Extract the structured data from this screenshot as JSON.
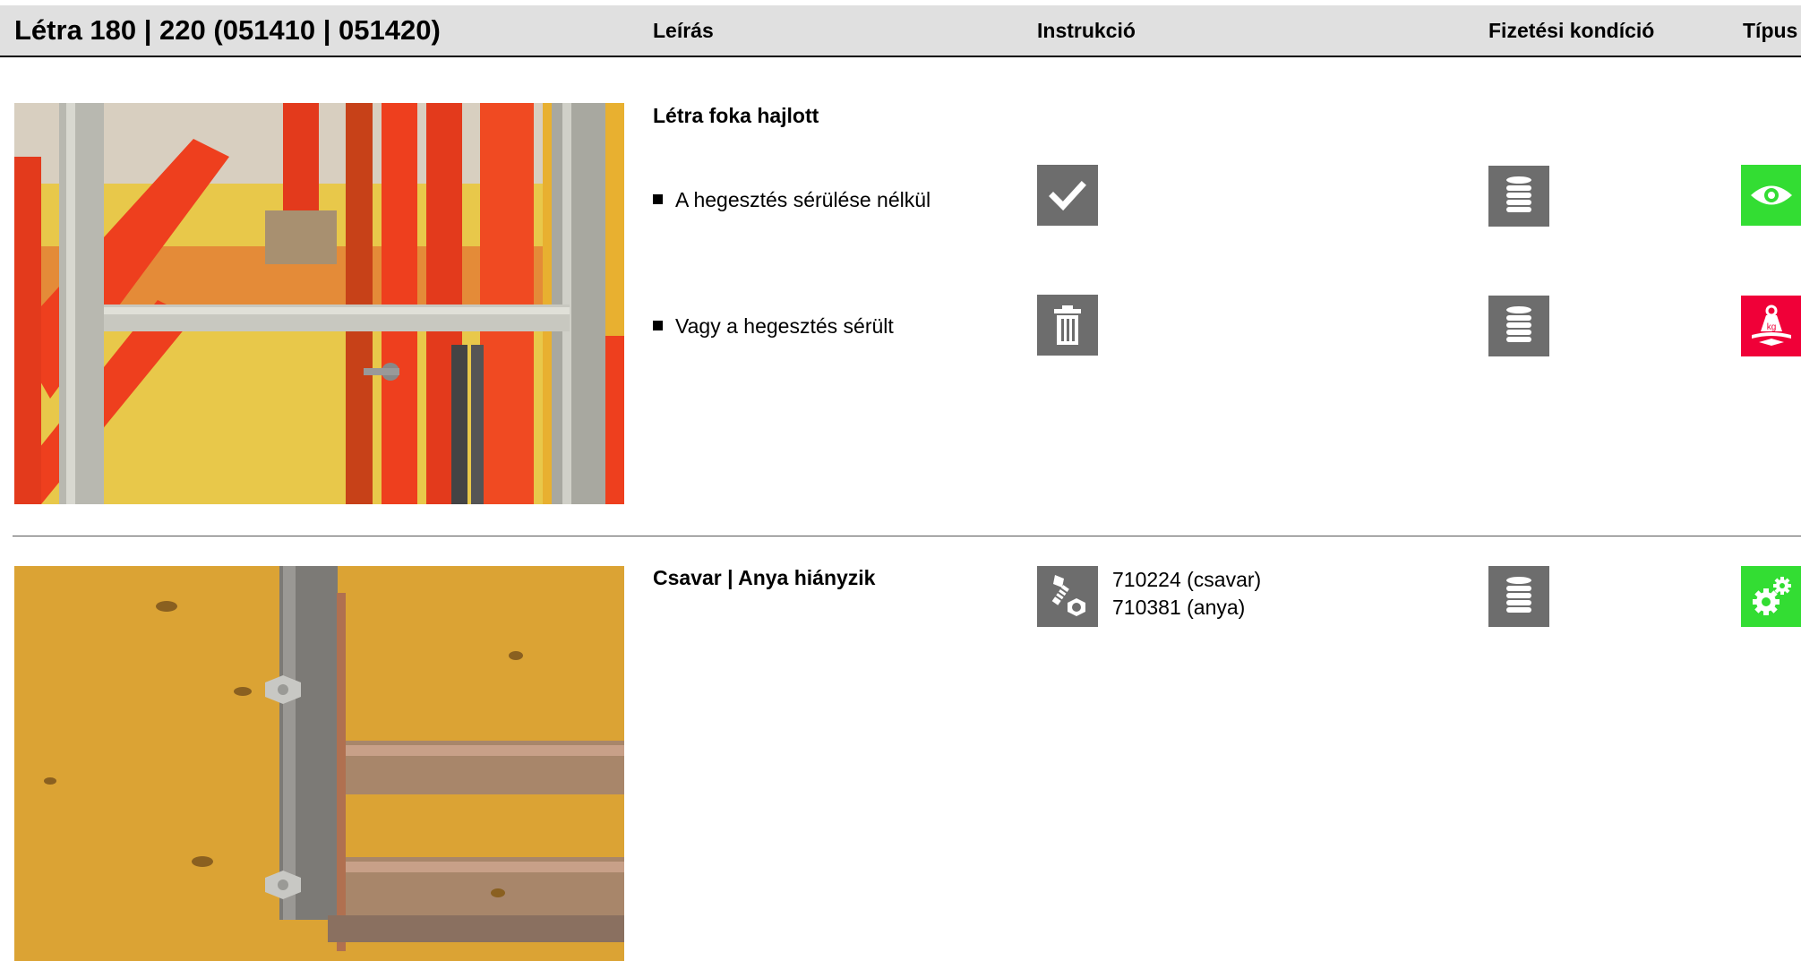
{
  "header": {
    "title": "Létra 180 | 220 (051410 | 051420)",
    "col_leiras": "Leírás",
    "col_instrukcio": "Instrukció",
    "col_fizetesi": "Fizetési kondíció",
    "col_tipus": "Típus"
  },
  "sections": [
    {
      "title": "Létra foka hajlott",
      "rows": [
        {
          "text": "A hegesztés sérülése nélkül",
          "instruction_icon": "checkmark-icon",
          "payment_icon": "coin-stack-icon",
          "type_icon": "eye-icon",
          "type_color": "#33dd33"
        },
        {
          "text": "Vagy a hegesztés sérült",
          "instruction_icon": "trash-icon",
          "payment_icon": "coin-stack-icon",
          "type_icon": "weight-kg-icon",
          "type_color": "#f00038",
          "type_icon_text": "kg"
        }
      ]
    },
    {
      "title": "Csavar | Anya hiányzik",
      "instruction_icon": "bolt-nut-icon",
      "parts": [
        "710224 (csavar)",
        "710381 (anya)"
      ],
      "payment_icon": "coin-stack-icon",
      "type_icon": "gears-icon",
      "type_color": "#33dd33"
    }
  ],
  "colors": {
    "header_bg": "#e0e0e0",
    "icon_gray": "#6d6d6d",
    "icon_green": "#33dd33",
    "icon_red": "#f00038"
  }
}
